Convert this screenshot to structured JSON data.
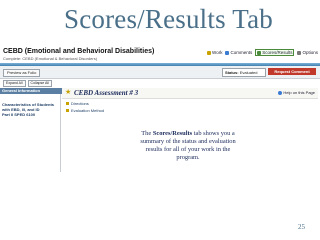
{
  "slide": {
    "title": "Scores/Results Tab",
    "page_number": "25",
    "caption_prefix": "The ",
    "caption_bold": "Scores/Results",
    "caption_suffix": " tab shows you a summary of the status and evaluation results for all of your work in the program."
  },
  "app": {
    "title": "CEBD (Emotional and Behavioral Disabilities)",
    "subtitle": "Complete: CEBD (Emotional & Behavioral Disorders)",
    "tabs": [
      {
        "label": "Work",
        "icon": "work-icon",
        "active": false
      },
      {
        "label": "Comments",
        "icon": "comments-icon",
        "active": false
      },
      {
        "label": "Scores/Results",
        "icon": "scores-icon",
        "active": true
      },
      {
        "label": "Options",
        "icon": "options-icon",
        "active": false
      }
    ],
    "toolbar": {
      "preview_label": "Preview as Folio",
      "status_label": "Status:",
      "status_value": "Evaluated",
      "request_label": "Request Comment"
    },
    "sidebar": {
      "expand_label": "Expand All",
      "collapse_label": "Collapse All",
      "section_header": "General Information",
      "section_link": "Characteristics of Students with EBD, I/I, and ID",
      "items": [
        "Part II SPED 6100"
      ]
    },
    "main": {
      "assessment_title": "CEBD Assessment # 3",
      "help_label": "Help on this Page",
      "items": [
        "Directions",
        "Evaluation Method"
      ]
    }
  },
  "colors": {
    "title": "#4a6f88",
    "accent_bar": "#3f7fb0",
    "request_button": "#c0392b",
    "caption": "#1a2a5a"
  }
}
